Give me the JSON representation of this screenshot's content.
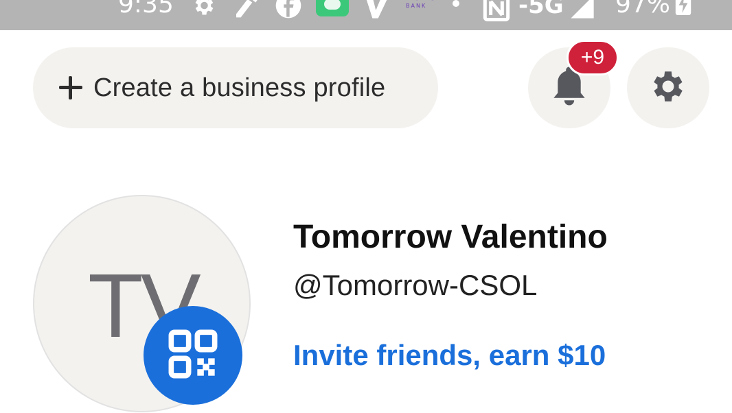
{
  "status_bar": {
    "time": "9:35",
    "carrier_app": "varo",
    "carrier_sub": "BANK",
    "network": "5G",
    "battery": "97%"
  },
  "header": {
    "create_business_label": "Create a business profile",
    "notification_badge": "+9"
  },
  "profile": {
    "initials": "TV",
    "name": "Tomorrow Valentino",
    "handle": "@Tomorrow-CSOL",
    "invite_text": "Invite friends, earn $10"
  },
  "colors": {
    "accent": "#1a6fdb",
    "badge": "#d0213a",
    "pill_bg": "#f3f2ef"
  }
}
